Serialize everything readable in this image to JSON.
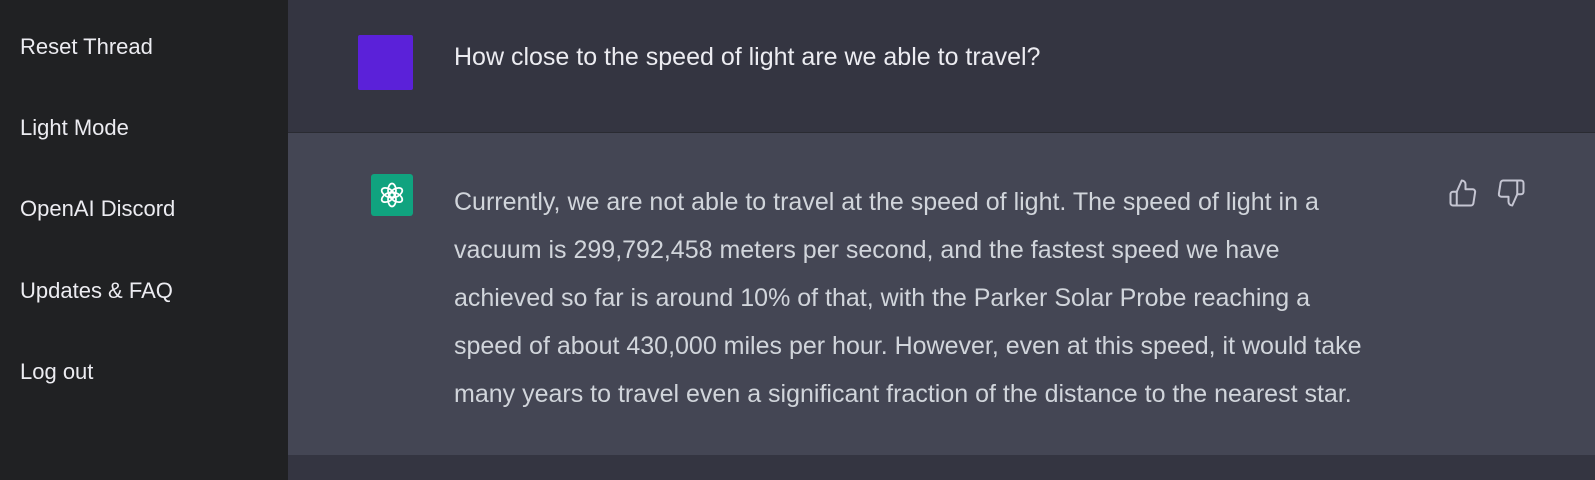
{
  "sidebar": {
    "items": [
      {
        "label": "Reset Thread"
      },
      {
        "label": "Light Mode"
      },
      {
        "label": "OpenAI Discord"
      },
      {
        "label": "Updates & FAQ"
      },
      {
        "label": "Log out"
      }
    ]
  },
  "conversation": {
    "user_message": "How close to the speed of light are we able to travel?",
    "assistant_lines": [
      "Currently, we are not able to travel at the speed of light. The speed of light in a",
      "vacuum is 299,792,458 meters per second, and the fastest speed we have",
      "achieved so far is around 10% of that, with the Parker Solar Probe reaching a",
      "speed of about 430,000 miles per hour. However, even at this speed, it would take",
      "many years to travel even a significant fraction of the distance to the nearest star."
    ]
  },
  "icons": {
    "user_avatar": "user-avatar",
    "assistant_avatar": "openai-logo-icon",
    "like": "thumbs-up-icon",
    "dislike": "thumbs-down-icon"
  },
  "colors": {
    "sidebar_bg": "#202123",
    "main_bg": "#343541",
    "assistant_bg": "#444654",
    "user_avatar": "#5b21d9",
    "assistant_avatar": "#10a37f"
  }
}
